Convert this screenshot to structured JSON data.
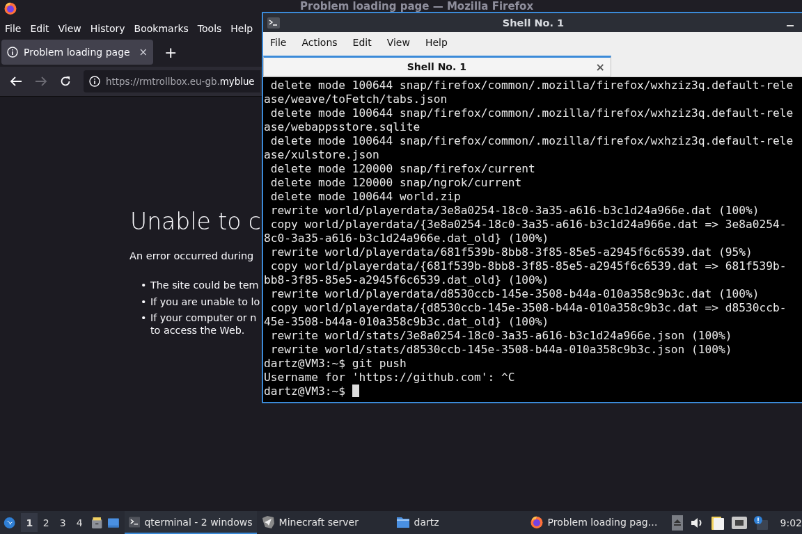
{
  "firefox": {
    "title": "Problem loading page — Mozilla Firefox",
    "menu": [
      "File",
      "Edit",
      "View",
      "History",
      "Bookmarks",
      "Tools",
      "Help"
    ],
    "tabs": [
      {
        "label": "Problem loading page",
        "selected": true,
        "close": "×"
      }
    ],
    "new_tab": "+",
    "url": {
      "prefix": "https://rmtrollbox.eu-gb.",
      "domain": "myblue"
    },
    "error": {
      "heading": "Unable to c",
      "message": "An error occurred during",
      "bullets": [
        {
          "marker": "•",
          "lines": [
            "The site could be tem"
          ]
        },
        {
          "marker": "•",
          "lines": [
            "If you are unable to lo"
          ]
        },
        {
          "marker": "•",
          "lines": [
            "If your computer or n",
            "to access the Web."
          ]
        }
      ]
    }
  },
  "terminal": {
    "title": "Shell No. 1",
    "menu": [
      "File",
      "Actions",
      "Edit",
      "View",
      "Help"
    ],
    "tabs": [
      {
        "label": "Shell No. 1",
        "selected": true,
        "close": "×"
      }
    ],
    "lines": [
      " delete mode 100644 snap/firefox/common/.mozilla/firefox/wxhziz3q.default-rele",
      "ase/weave/toFetch/tabs.json",
      " delete mode 100644 snap/firefox/common/.mozilla/firefox/wxhziz3q.default-rele",
      "ase/webappsstore.sqlite",
      " delete mode 100644 snap/firefox/common/.mozilla/firefox/wxhziz3q.default-rele",
      "ase/xulstore.json",
      " delete mode 120000 snap/firefox/current",
      " delete mode 120000 snap/ngrok/current",
      " delete mode 100644 world.zip",
      " rewrite world/playerdata/3e8a0254-18c0-3a35-a616-b3c1d24a966e.dat (100%)",
      " copy world/playerdata/{3e8a0254-18c0-3a35-a616-b3c1d24a966e.dat => 3e8a0254-",
      "8c0-3a35-a616-b3c1d24a966e.dat_old} (100%)",
      " rewrite world/playerdata/681f539b-8bb8-3f85-85e5-a2945f6c6539.dat (95%)",
      " copy world/playerdata/{681f539b-8bb8-3f85-85e5-a2945f6c6539.dat => 681f539b-",
      "bb8-3f85-85e5-a2945f6c6539.dat_old} (100%)",
      " rewrite world/playerdata/d8530ccb-145e-3508-b44a-010a358c9b3c.dat (100%)",
      " copy world/playerdata/{d8530ccb-145e-3508-b44a-010a358c9b3c.dat => d8530ccb-",
      "45e-3508-b44a-010a358c9b3c.dat_old} (100%)",
      " rewrite world/stats/3e8a0254-18c0-3a35-a616-b3c1d24a966e.json (100%)",
      " rewrite world/stats/d8530ccb-145e-3508-b44a-010a358c9b3c.json (100%)",
      "dartz@VM3:~$ git push",
      "Username for 'https://github.com': ^C",
      "dartz@VM3:~$ "
    ]
  },
  "taskbar": {
    "desktops": [
      {
        "label": "1",
        "selected": true
      },
      {
        "label": "2",
        "selected": false
      },
      {
        "label": "3",
        "selected": false
      },
      {
        "label": "4",
        "selected": false
      }
    ],
    "tasks": [
      {
        "kind": "terminal",
        "label": "qterminal - 2 windows",
        "selected": true
      },
      {
        "kind": "minecraft",
        "label": "Minecraft server",
        "selected": false
      },
      {
        "kind": "folder",
        "label": "dartz",
        "selected": false
      },
      {
        "kind": "firefox",
        "label": "Problem loading pag…",
        "selected": false
      }
    ],
    "clock": "9:02"
  }
}
